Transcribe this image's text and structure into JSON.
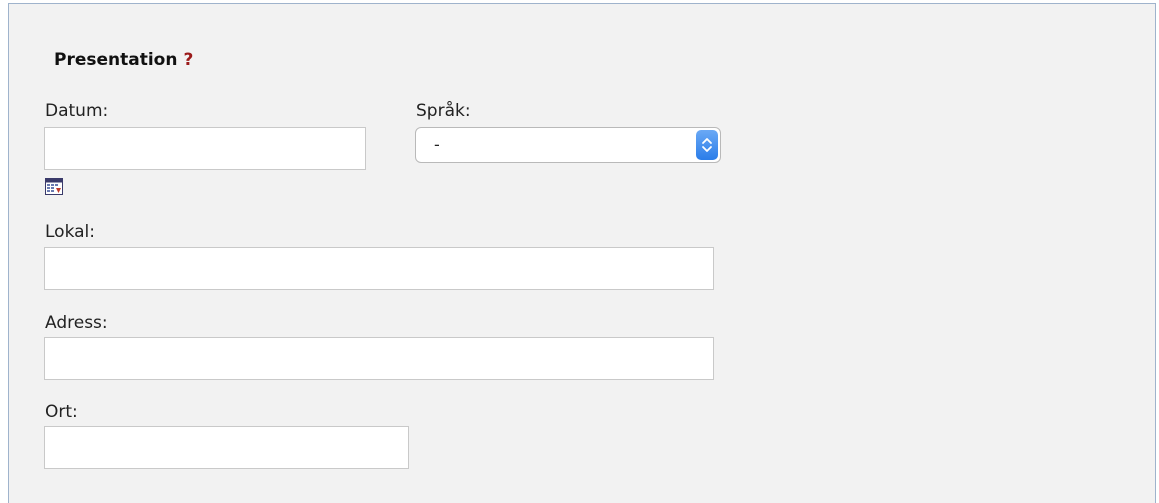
{
  "section": {
    "title": "Presentation",
    "help_symbol": "?"
  },
  "form": {
    "datum": {
      "label": "Datum:",
      "value": ""
    },
    "sprak": {
      "label": "Språk:",
      "selected": "-"
    },
    "lokal": {
      "label": "Lokal:",
      "value": ""
    },
    "adress": {
      "label": "Adress:",
      "value": ""
    },
    "ort": {
      "label": "Ort:",
      "value": ""
    }
  },
  "icons": {
    "calendar": "calendar-icon",
    "select_arrows": "chevron-updown-icon"
  },
  "colors": {
    "panel_bg": "#f2f2f2",
    "help": "#9b1a1a",
    "select_accent": "#2b7de9",
    "field_border": "#c9c9c9"
  }
}
